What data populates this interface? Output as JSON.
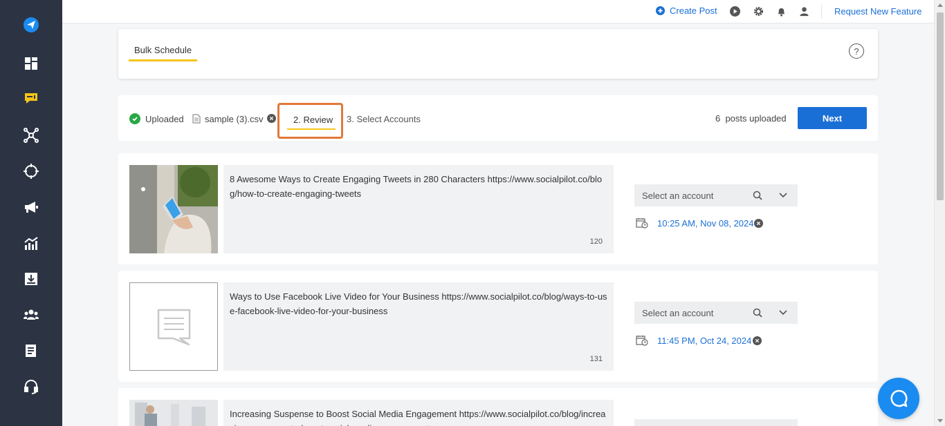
{
  "sidebar": {
    "items": [
      {
        "name": "logo-send-icon",
        "color": "#1a8bf0"
      },
      {
        "name": "dashboard-icon",
        "color": "#ffffff"
      },
      {
        "name": "posts-icon",
        "color": "#f5c518"
      },
      {
        "name": "connections-icon",
        "color": "#ffffff"
      },
      {
        "name": "target-icon",
        "color": "#ffffff"
      },
      {
        "name": "megaphone-icon",
        "color": "#ffffff"
      },
      {
        "name": "analytics-icon",
        "color": "#ffffff"
      },
      {
        "name": "inbox-download-icon",
        "color": "#ffffff"
      },
      {
        "name": "team-icon",
        "color": "#ffffff"
      },
      {
        "name": "reports-icon",
        "color": "#ffffff"
      },
      {
        "name": "support-headset-icon",
        "color": "#ffffff"
      }
    ]
  },
  "topbar": {
    "create_post": "Create Post",
    "request_feature": "Request New Feature"
  },
  "header": {
    "tab_label": "Bulk Schedule",
    "help": "?"
  },
  "steps": {
    "uploaded": "Uploaded",
    "file_name": "sample (3).csv",
    "review": "2. Review",
    "select_accounts": "3. Select Accounts",
    "posts_uploaded": "6  posts uploaded",
    "next": "Next"
  },
  "posts": [
    {
      "text": "8 Awesome Ways to Create Engaging Tweets in 280 Characters https://www.socialpilot.co/blog/how-to-create-engaging-tweets",
      "count": "120",
      "account_placeholder": "Select an account",
      "schedule": "10:25 AM, Nov 08, 2024",
      "thumb": "photo"
    },
    {
      "text": "Ways to Use Facebook Live Video for Your Business https://www.socialpilot.co/blog/ways-to-use-facebook-live-video-for-your-business",
      "count": "131",
      "account_placeholder": "Select an account",
      "schedule": "11:45 PM, Oct 24, 2024",
      "thumb": "placeholder"
    },
    {
      "text": "Increasing Suspense to Boost Social Media Engagement https://www.socialpilot.co/blog/increasing-suspense-to-boost-social-media-engagement",
      "count": "",
      "account_placeholder": "",
      "schedule": "",
      "thumb": "photo"
    }
  ],
  "colors": {
    "accent_blue": "#1a6fd6",
    "highlight_orange": "#e2773a",
    "underline_yellow": "#f5c518",
    "success_green": "#27a745",
    "sidebar_bg": "#2c3444"
  }
}
